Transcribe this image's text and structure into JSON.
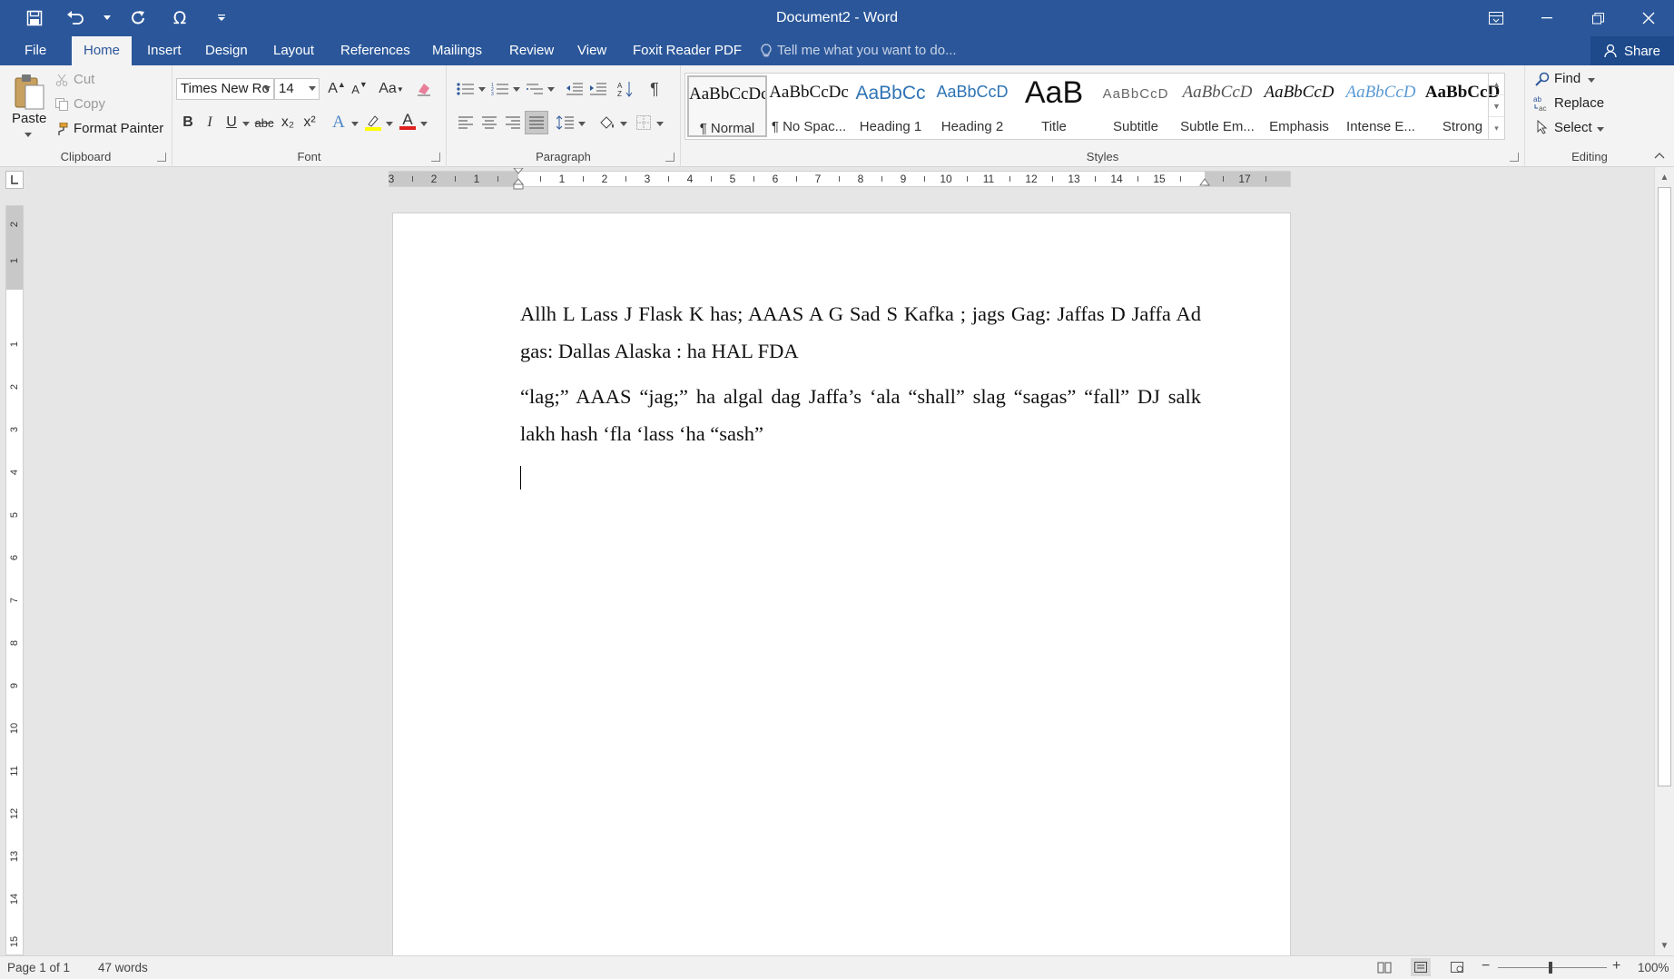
{
  "app": {
    "title": "Document2 - Word"
  },
  "icons": {
    "save": "save-icon",
    "undo": "undo-icon",
    "redo": "redo-icon",
    "symbol": "omega-icon",
    "customize": "chevron-down-icon"
  },
  "tabs": [
    "File",
    "Home",
    "Insert",
    "Design",
    "Layout",
    "References",
    "Mailings",
    "Review",
    "View",
    "Foxit Reader PDF"
  ],
  "tellme": {
    "placeholder": "Tell me what you want to do..."
  },
  "share": {
    "label": "Share"
  },
  "clipboard": {
    "label": "Clipboard",
    "paste": "Paste",
    "cut": "Cut",
    "copy": "Copy",
    "format_painter": "Format Painter"
  },
  "font": {
    "label": "Font",
    "name": "Times New Ro",
    "size": "14",
    "change_case": "Aa",
    "bold": "B",
    "italic": "I",
    "underline": "U",
    "strikethrough": "abc",
    "subscript": "x₂",
    "superscript": "x²",
    "text_effects": "A",
    "font_color": "A",
    "grow": "A",
    "shrink": "A"
  },
  "paragraph": {
    "label": "Paragraph"
  },
  "styles": {
    "label": "Styles",
    "items": [
      {
        "preview": "AaBbCcDc",
        "name": "¶ Normal"
      },
      {
        "preview": "AaBbCcDc",
        "name": "¶ No Spac..."
      },
      {
        "preview": "AaBbCc",
        "name": "Heading 1"
      },
      {
        "preview": "AaBbCcD",
        "name": "Heading 2"
      },
      {
        "preview": "AaB",
        "name": "Title"
      },
      {
        "preview": "AaBbCcD",
        "name": "Subtitle"
      },
      {
        "preview": "AaBbCcD",
        "name": "Subtle Em..."
      },
      {
        "preview": "AaBbCcD",
        "name": "Emphasis"
      },
      {
        "preview": "AaBbCcD",
        "name": "Intense E..."
      },
      {
        "preview": "AaBbCcD",
        "name": "Strong"
      }
    ]
  },
  "editing": {
    "label": "Editing",
    "find": "Find",
    "replace": "Replace",
    "select": "Select"
  },
  "ruler": {
    "h_numbers": [
      "3",
      "2",
      "1",
      "1",
      "2",
      "3",
      "4",
      "5",
      "6",
      "7",
      "8",
      "9",
      "10",
      "11",
      "12",
      "13",
      "14",
      "15",
      "17"
    ],
    "v_numbers": [
      "2",
      "1",
      "1",
      "2",
      "3",
      "4",
      "5",
      "6",
      "7",
      "8",
      "9",
      "10",
      "11",
      "12",
      "13",
      "14",
      "15"
    ]
  },
  "document": {
    "paragraphs": [
      "Allh L Lass J Flask K has; AAAS A G Sad S Kafka ; jags Gag: Jaffas D Jaffa Ad gas: Dallas Alaska : ha HAL FDA",
      "“lag;” AAAS “jag;” ha algal dag Jaffa’s ‘ala “shall” slag “sagas” “fall” DJ salk lakh hash ‘fla ‘lass ‘ha “sash”"
    ]
  },
  "status": {
    "page": "Page 1 of 1",
    "words": "47 words",
    "zoom": "100%",
    "zoom_minus": "−",
    "zoom_plus": "+"
  }
}
